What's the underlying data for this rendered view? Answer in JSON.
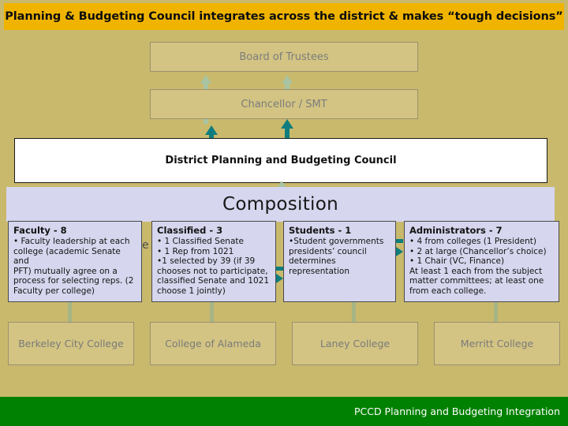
{
  "slide": {
    "background_color": "#c9b96d",
    "title": "Planning & Budgeting Council integrates across the district & makes “tough decisions”",
    "title_bar_color": "#f0b400"
  },
  "hierarchy": {
    "board_label": "Board of Trustees",
    "chancellor_label": "Chancellor / SMT",
    "council_label": "District Planning and Budgeting Council"
  },
  "composition": {
    "heading": "Composition",
    "band_color": "#d6d6ee",
    "peek_label": "e",
    "cards": [
      {
        "title": "Faculty - 8",
        "lines": [
          "• Faculty leadership at each",
          "college (academic Senate and",
          "PFT) mutually agree on a",
          "process for selecting reps. (2",
          "Faculty per college)"
        ]
      },
      {
        "title": "Classified - 3",
        "lines": [
          "• 1 Classified Senate",
          "• 1 Rep from 1021",
          "•1 selected by 39 (if 39",
          "chooses not to participate,",
          "classified Senate and 1021",
          "choose 1 jointly)"
        ]
      },
      {
        "title": "Students - 1",
        "lines": [
          "•Student governments",
          "presidents’ council",
          "determines",
          "representation"
        ]
      },
      {
        "title": "Administrators - 7",
        "lines": [
          "• 4 from colleges (1 President)",
          "• 2 at large (Chancellor’s choice)",
          "• 1 Chair (VC, Finance)",
          "At least 1 each from the subject",
          "matter committees; at least one",
          "from each college."
        ]
      }
    ]
  },
  "colleges": [
    {
      "label": "Berkeley City College"
    },
    {
      "label": "College of Alameda"
    },
    {
      "label": "Laney College"
    },
    {
      "label": "Merritt College"
    }
  ],
  "footer": {
    "text": "PCCD Planning and Budgeting Integration",
    "color": "#018101"
  }
}
